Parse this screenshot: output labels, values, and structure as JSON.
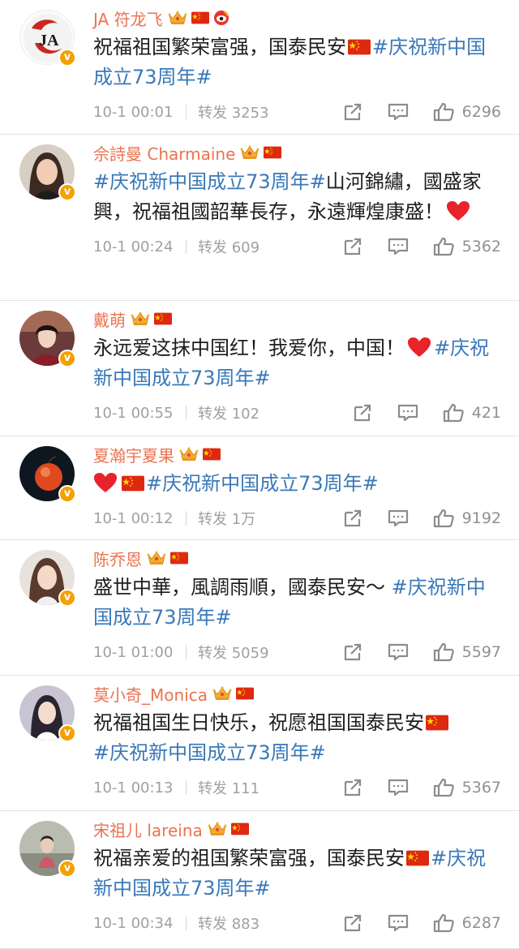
{
  "colors": {
    "name": "#eb7350",
    "tag": "#3a78b8",
    "meta": "#a0a0a0",
    "badge": "#f5a000"
  },
  "posts": [
    {
      "name": "JA 符龙飞",
      "avatar_text": "JA",
      "icons": [
        "crown-icon",
        "china-flag-icon",
        "weibo-eye-icon"
      ],
      "text_a": "祝福祖国繁荣富强，国泰民安",
      "tag": "#庆祝新中国成立73周年#",
      "time": "10-1 00:01",
      "repost": "转发 3253",
      "likes": "6296"
    },
    {
      "name": "佘詩曼 Charmaine",
      "icons": [
        "crown-icon",
        "china-flag-icon"
      ],
      "tag": "#庆祝新中国成立73周年#",
      "text_b": "山河錦繡，國盛家興，祝福祖國韶華長存，永遠輝煌康盛！",
      "time": "10-1 00:24",
      "repost": "转发 609",
      "likes": "5362"
    },
    {
      "name": "戴萌",
      "icons": [
        "crown-icon",
        "china-flag-icon"
      ],
      "text_a": "永远爱这抹中国红！我爱你，中国！",
      "tag": "#庆祝新中国成立73周年#",
      "time": "10-1 00:55",
      "repost": "转发 102",
      "likes": "421"
    },
    {
      "name": "夏瀚宇夏果",
      "icons": [
        "crown-icon",
        "china-flag-icon"
      ],
      "tag": "#庆祝新中国成立73周年#",
      "time": "10-1 00:12",
      "repost": "转发 1万",
      "likes": "9192"
    },
    {
      "name": "陈乔恩",
      "icons": [
        "crown-icon",
        "china-flag-icon"
      ],
      "text_a": "盛世中華，風調雨順，國泰民安～ ",
      "tag": "#庆祝新中国成立73周年#",
      "time": "10-1 01:00",
      "repost": "转发 5059",
      "likes": "5597"
    },
    {
      "name": "莫小奇_Monica",
      "icons": [
        "crown-icon",
        "china-flag-icon"
      ],
      "text_a": "祝福祖国生日快乐，祝愿祖国国泰民安",
      "tag": "#庆祝新中国成立73周年#",
      "time": "10-1 00:13",
      "repost": "转发 111",
      "likes": "5367"
    },
    {
      "name": "宋祖儿 lareina",
      "icons": [
        "crown-icon",
        "china-flag-icon"
      ],
      "text_a": "祝福亲爱的祖国繁荣富强，国泰民安",
      "tag": "#庆祝新中国成立73周年#",
      "time": "10-1 00:34",
      "repost": "转发 883",
      "likes": "6287"
    }
  ]
}
